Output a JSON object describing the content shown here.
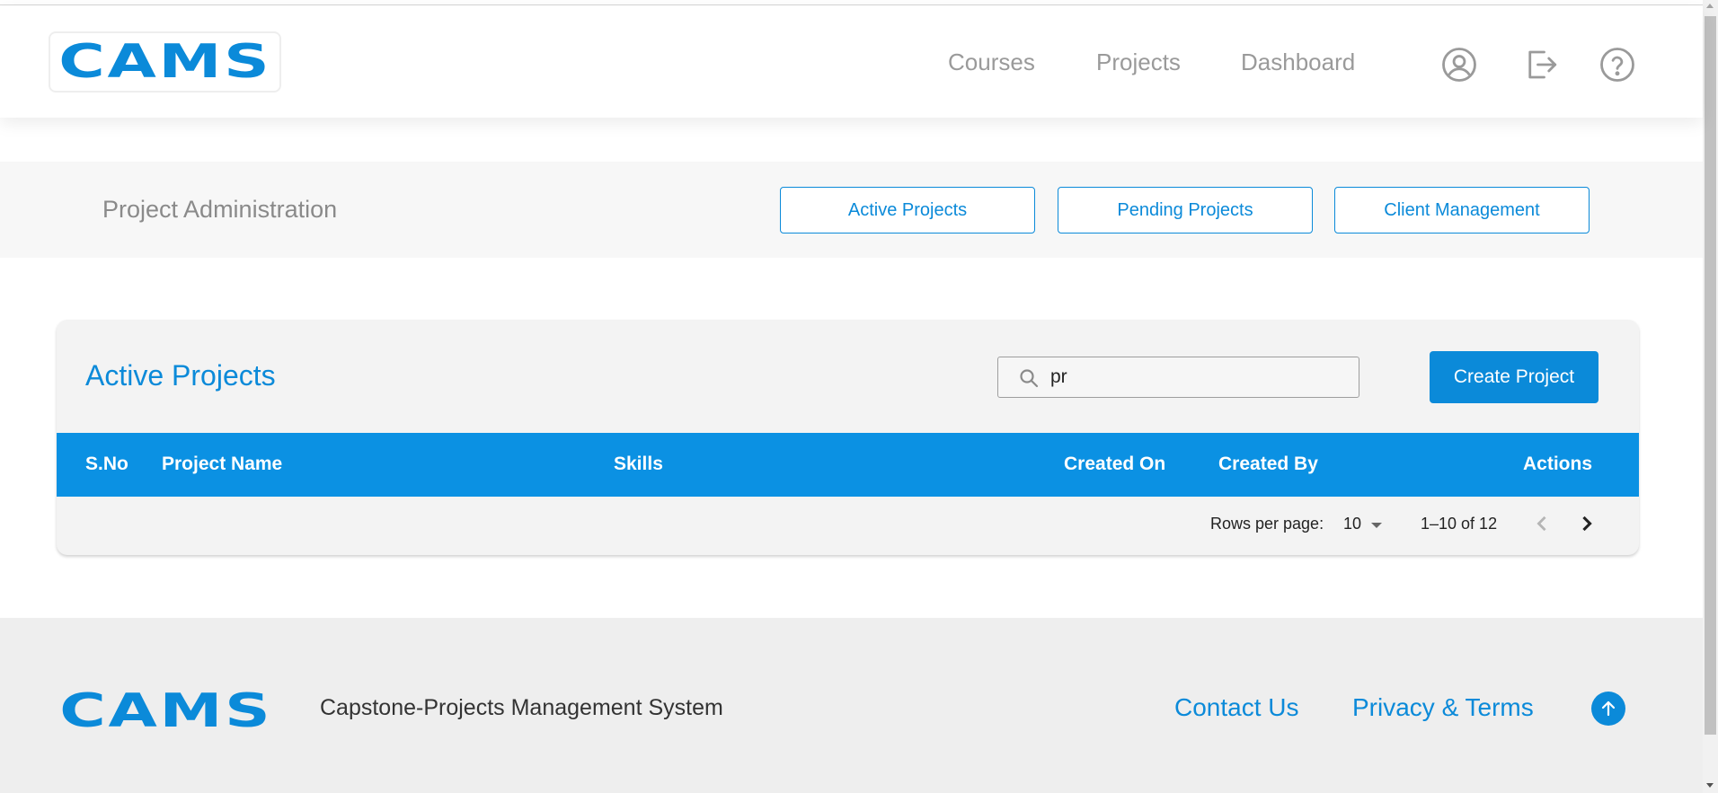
{
  "header": {
    "logo_text": "CAMS",
    "nav": {
      "courses": "Courses",
      "projects": "Projects",
      "dashboard": "Dashboard"
    },
    "icons": [
      "account-circle-icon",
      "logout-icon",
      "help-icon"
    ]
  },
  "admin": {
    "title": "Project Administration",
    "tabs": {
      "active": "Active Projects",
      "pending": "Pending Projects",
      "client": "Client Management"
    }
  },
  "card": {
    "title": "Active Projects",
    "search": {
      "value": "pr",
      "placeholder": "",
      "icon": "search-icon"
    },
    "create_label": "Create Project",
    "columns": {
      "sno": "S.No",
      "name": "Project Name",
      "skills": "Skills",
      "created_on": "Created On",
      "created_by": "Created By",
      "actions": "Actions"
    },
    "rows": [],
    "pagination": {
      "rows_label": "Rows per page:",
      "rows_per_page": "10",
      "range": "1–10 of 12"
    }
  },
  "footer": {
    "logo_text": "CAMS",
    "tagline": "Capstone-Projects Management System",
    "links": {
      "contact": "Contact Us",
      "privacy": "Privacy & Terms"
    }
  },
  "colors": {
    "accent": "#0b8ad9",
    "table_header": "#0b91e3",
    "nav_text": "#9a9a9a",
    "footer_bg": "#eeeeee"
  }
}
